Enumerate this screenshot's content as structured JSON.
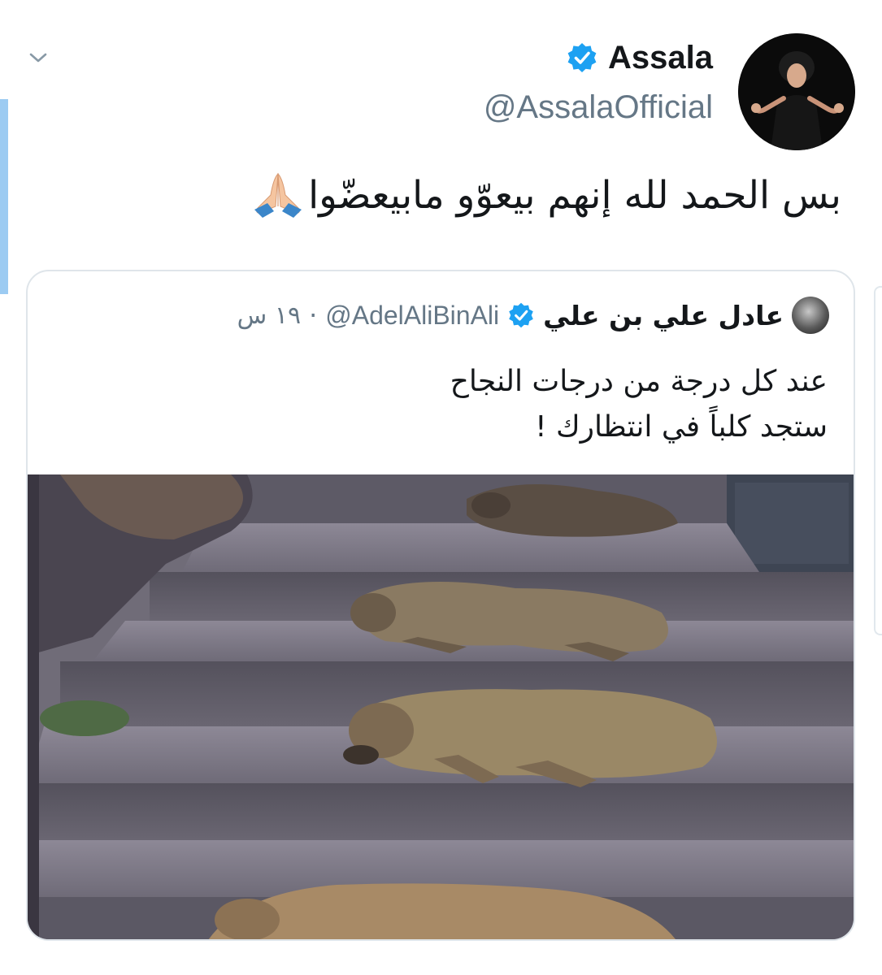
{
  "tweet": {
    "author": {
      "display_name": "Assala",
      "handle": "@AssalaOfficial",
      "verified": true,
      "avatar_icon": "profile-photo"
    },
    "text": "بس الحمد لله إنهم بيعوّو مابيعضّوا",
    "emoji": "folded-hands",
    "menu_icon": "chevron-down-icon"
  },
  "quoted_tweet": {
    "author": {
      "display_name": "عادل علي بن علي",
      "handle": "@AdelAliBinAli",
      "verified": true
    },
    "separator": "·",
    "time": "١٩ س",
    "text_lines": [
      "عند كل درجة من درجات النجاح",
      "ستجد كلباً في انتظارك !"
    ],
    "media": {
      "type": "photo",
      "description_icon": "photo-dogs-on-steps"
    }
  },
  "colors": {
    "verified_blue": "#1da1f2",
    "secondary_text": "#657786",
    "border": "#dfe5ea",
    "accent_bar": "#9ccbf2"
  }
}
